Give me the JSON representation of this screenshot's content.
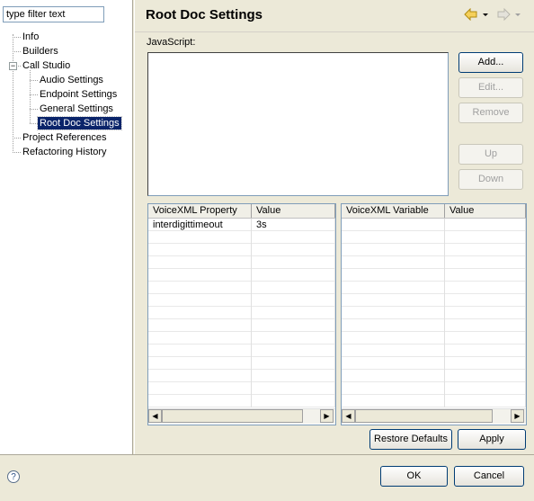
{
  "filter": {
    "value": "type filter text"
  },
  "tree": {
    "items": [
      {
        "label": "Info"
      },
      {
        "label": "Builders"
      },
      {
        "label": "Call Studio"
      },
      {
        "label": "Audio Settings"
      },
      {
        "label": "Endpoint Settings"
      },
      {
        "label": "General Settings"
      },
      {
        "label": "Root Doc Settings"
      },
      {
        "label": "Project References"
      },
      {
        "label": "Refactoring History"
      }
    ]
  },
  "header": {
    "title": "Root Doc Settings"
  },
  "javascript": {
    "label": "JavaScript:",
    "buttons": {
      "add": "Add...",
      "edit": "Edit...",
      "remove": "Remove",
      "up": "Up",
      "down": "Down"
    }
  },
  "properties_table": {
    "columns": [
      "VoiceXML Property",
      "Value"
    ],
    "rows": [
      {
        "property": "interdigittimeout",
        "value": "3s"
      }
    ]
  },
  "variables_table": {
    "columns": [
      "VoiceXML Variable",
      "Value"
    ],
    "rows": []
  },
  "actions": {
    "restore_defaults": "Restore Defaults",
    "apply": "Apply"
  },
  "dialog": {
    "ok": "OK",
    "cancel": "Cancel"
  },
  "colors": {
    "selection": "#0a246a",
    "panel_bg": "#ece9d8",
    "border": "#7f9db9"
  }
}
